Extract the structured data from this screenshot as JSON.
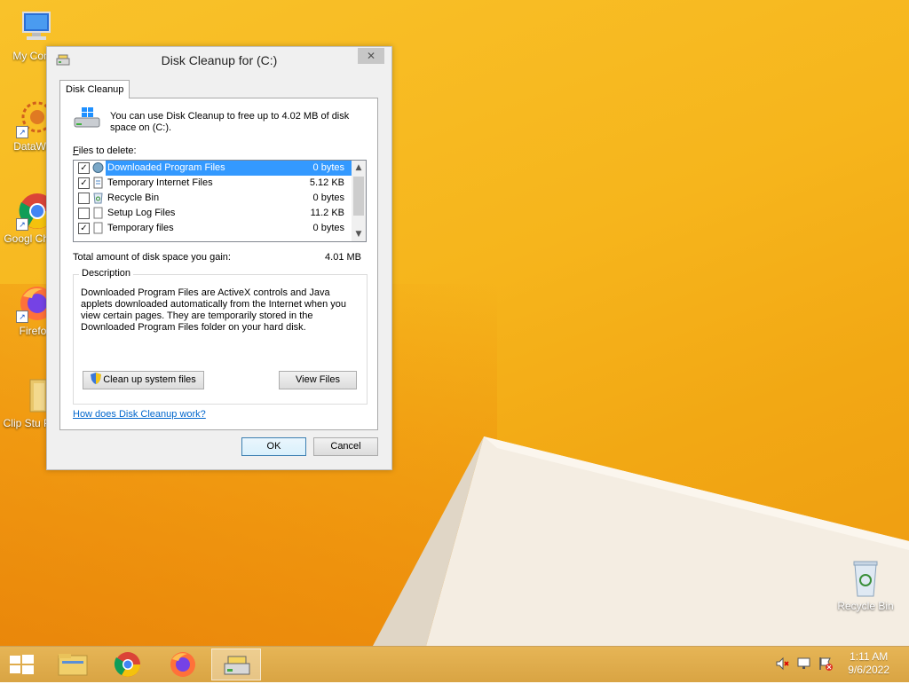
{
  "desktop": {
    "icons": [
      {
        "label": "My Comp"
      },
      {
        "label": "DataWag"
      },
      {
        "label": "Googl Chrom"
      },
      {
        "label": "Firefox"
      },
      {
        "label": "Clip Stu Paint"
      },
      {
        "label": "Recycle Bin"
      }
    ]
  },
  "window": {
    "title": "Disk Cleanup for  (C:)",
    "close_label": "✕",
    "tab_label": "Disk Cleanup",
    "intro": "You can use Disk Cleanup to free up to 4.02 MB of disk space on  (C:).",
    "files_label_prefix": "F",
    "files_label_rest": "iles to delete:",
    "files": [
      {
        "name": "Downloaded Program Files",
        "size": "0 bytes",
        "checked": true,
        "selected": true
      },
      {
        "name": "Temporary Internet Files",
        "size": "5.12 KB",
        "checked": true,
        "selected": false
      },
      {
        "name": "Recycle Bin",
        "size": "0 bytes",
        "checked": false,
        "selected": false
      },
      {
        "name": "Setup Log Files",
        "size": "11.2 KB",
        "checked": false,
        "selected": false
      },
      {
        "name": "Temporary files",
        "size": "0 bytes",
        "checked": true,
        "selected": false
      }
    ],
    "total_label": "Total amount of disk space you gain:",
    "total_value": "4.01 MB",
    "description_legend": "Description",
    "description_text": "Downloaded Program Files are ActiveX controls and Java applets downloaded automatically from the Internet when you view certain pages. They are temporarily stored in the Downloaded Program Files folder on your hard disk.",
    "cleanup_system_button": "Clean up system files",
    "view_files_button": "View Files",
    "help_link": "How does Disk Cleanup work?",
    "ok_button": "OK",
    "cancel_button": "Cancel"
  },
  "taskbar": {
    "clock_time": "1:11 AM",
    "clock_date": "9/6/2022"
  },
  "colors": {
    "selection": "#3399ff",
    "link": "#0066cc",
    "desktop": "#f6b51c"
  }
}
